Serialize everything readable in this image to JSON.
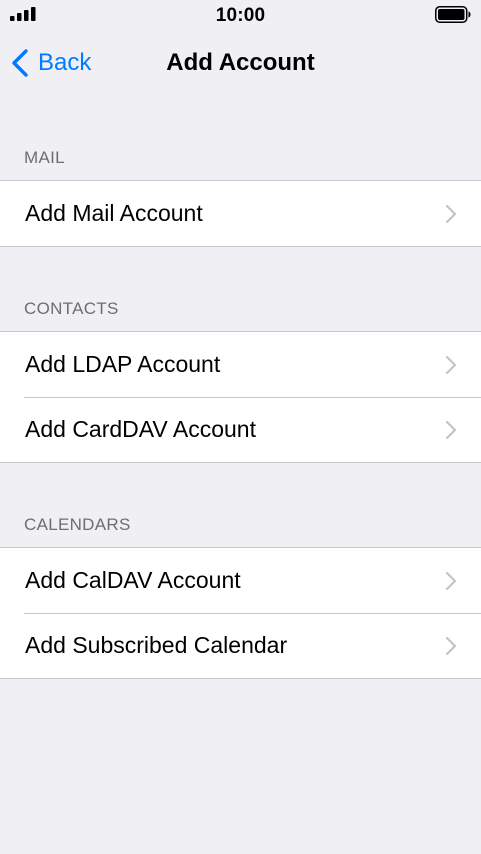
{
  "status_bar": {
    "time": "10:00",
    "signal_icon": "cellular-signal-icon",
    "battery_icon": "battery-full-icon"
  },
  "nav": {
    "back_label": "Back",
    "title": "Add Account"
  },
  "sections": [
    {
      "header": "MAIL",
      "rows": [
        {
          "label": "Add Mail Account"
        }
      ]
    },
    {
      "header": "CONTACTS",
      "rows": [
        {
          "label": "Add LDAP Account"
        },
        {
          "label": "Add CardDAV Account"
        }
      ]
    },
    {
      "header": "CALENDARS",
      "rows": [
        {
          "label": "Add CalDAV Account"
        },
        {
          "label": "Add Subscribed Calendar"
        }
      ]
    }
  ],
  "colors": {
    "accent": "#007aff",
    "background": "#efeff4",
    "separator": "#c8c7cc",
    "secondary_text": "#6d6d72",
    "chevron": "#c4c4c9"
  }
}
